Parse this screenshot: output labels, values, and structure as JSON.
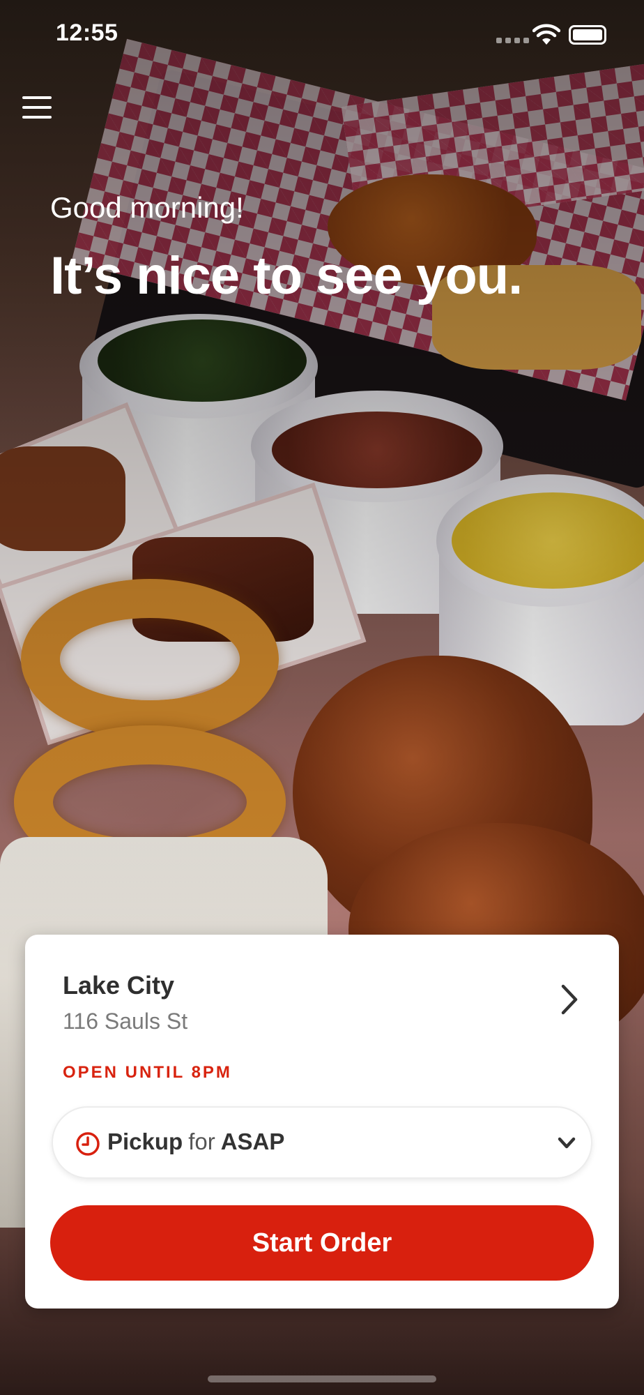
{
  "status_bar": {
    "time": "12:55"
  },
  "menu": {
    "icon": "hamburger-menu-icon"
  },
  "greeting": {
    "salutation": "Good morning!",
    "headline": "It’s nice to see you."
  },
  "location_card": {
    "name": "Lake City",
    "address": "116 Sauls St",
    "hours_status": "OPEN UNTIL 8PM",
    "order_mode": {
      "mode": "Pickup",
      "connector": "for",
      "time": "ASAP"
    },
    "start_button_label": "Start Order"
  },
  "colors": {
    "accent": "#d8200e",
    "card_background": "#ffffff",
    "status_text": "#d8230f"
  }
}
